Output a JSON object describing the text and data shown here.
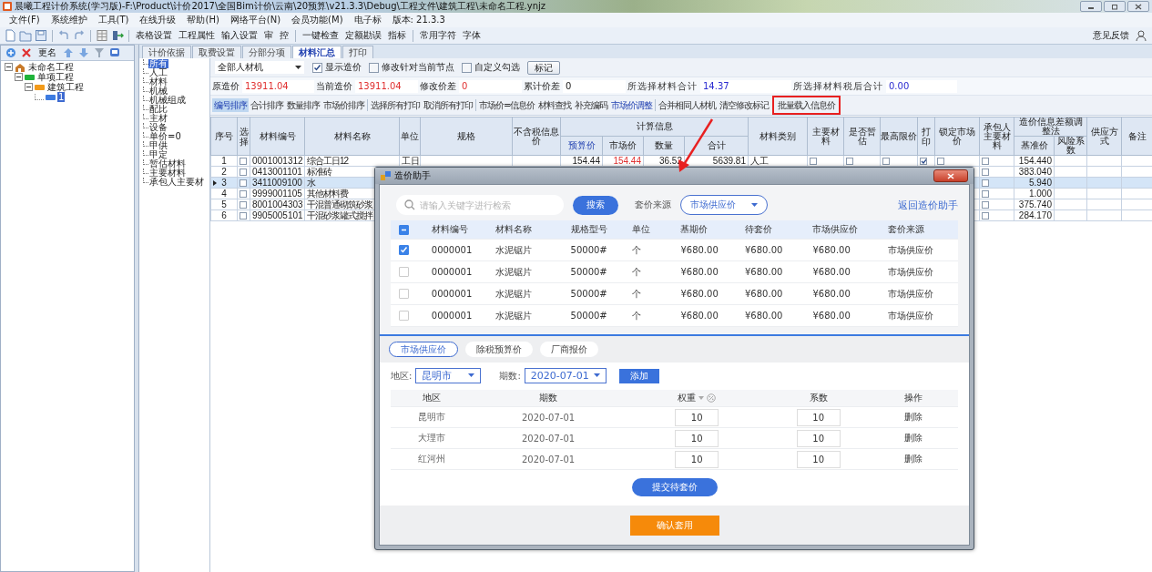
{
  "window": {
    "title": "晨曦工程计价系统(学习版)-F:\\Product\\计价2017\\全国Bim计价\\云南\\20预算\\v21.3.3\\Debug\\工程文件\\建筑工程\\未命名工程.ynjz"
  },
  "menu": [
    "文件(F)",
    "系统维护",
    "工具(T)",
    "在线升级",
    "帮助(H)",
    "网络平台(N)",
    "会员功能(M)",
    "电子标"
  ],
  "version": "版本: 21.3.3",
  "toolbar": [
    "表格设置",
    "工程属性",
    "输入设置",
    "审",
    "控",
    "一键检查",
    "定额勘误",
    "指标",
    "常用字符",
    "字体"
  ],
  "feedback": "意见反馈",
  "tree_toolbar": {
    "rename": "更名"
  },
  "tree": [
    {
      "label": "未命名工程",
      "kind": "project",
      "expanded": true,
      "selected": false,
      "children": [
        {
          "label": "单项工程",
          "kind": "single",
          "expanded": true,
          "selected": false,
          "children": [
            {
              "label": "建筑工程",
              "kind": "unit",
              "expanded": true,
              "selected": false,
              "children": [
                {
                  "label": "1",
                  "kind": "leaf",
                  "selected": true
                }
              ]
            }
          ]
        }
      ]
    }
  ],
  "tabs": [
    {
      "label": "计价依据",
      "selected": false
    },
    {
      "label": "取费设置",
      "selected": false
    },
    {
      "label": "分部分项",
      "selected": false
    },
    {
      "label": "材料汇总",
      "selected": true
    },
    {
      "label": "打印",
      "selected": false
    }
  ],
  "categories": [
    {
      "label": "所有",
      "selected": true
    },
    {
      "label": "人工",
      "selected": false
    },
    {
      "label": "材料",
      "selected": false
    },
    {
      "label": "机械",
      "selected": false
    },
    {
      "label": "机械组成",
      "selected": false
    },
    {
      "label": "配比",
      "selected": false
    },
    {
      "label": "主材",
      "selected": false
    },
    {
      "label": "设备",
      "selected": false
    },
    {
      "label": "单价=0",
      "selected": false
    },
    {
      "label": "甲供",
      "selected": false
    },
    {
      "label": "甲定",
      "selected": false
    },
    {
      "label": "暂估材料",
      "selected": false
    },
    {
      "label": "主要材料",
      "selected": false
    },
    {
      "label": "承包人主要材",
      "selected": false
    }
  ],
  "filter": {
    "dropdown": "全部人材机",
    "options": [
      {
        "label": "显示造价",
        "checked": true
      },
      {
        "label": "修改针对当前节点",
        "checked": false
      },
      {
        "label": "自定义勾选",
        "checked": false
      }
    ],
    "button": "标记"
  },
  "summary": [
    {
      "label": "原造价",
      "value": "13911.04"
    },
    {
      "label": "当前造价",
      "value": "13911.04"
    },
    {
      "label": "修改价差",
      "value": "0"
    },
    {
      "label": "累计价差",
      "value": "0"
    },
    {
      "label": "所选择材料合计",
      "value": "14.37"
    },
    {
      "label": "所选择材料税后合计",
      "value": "0.00"
    }
  ],
  "actions": [
    [
      {
        "label": "编号排序",
        "kind": "plain",
        "selected": true,
        "highlighted": false
      },
      {
        "label": "合计排序",
        "kind": "plain",
        "selected": false,
        "highlighted": false
      },
      {
        "label": "数量排序",
        "kind": "plain",
        "selected": false,
        "highlighted": false
      },
      {
        "label": "市场价排序",
        "kind": "plain",
        "selected": false,
        "highlighted": false
      }
    ],
    [
      {
        "label": "选择所有打印",
        "kind": "plain",
        "selected": false,
        "highlighted": false
      },
      {
        "label": "取消所有打印",
        "kind": "plain",
        "selected": false,
        "highlighted": false
      }
    ],
    [
      {
        "label": "市场价=信息价",
        "kind": "plain",
        "selected": false,
        "highlighted": false
      },
      {
        "label": "材料查找",
        "kind": "plain",
        "selected": false,
        "highlighted": false
      },
      {
        "label": "补充编码",
        "kind": "plain",
        "selected": false,
        "highlighted": false
      },
      {
        "label": "市场价调整",
        "kind": "link",
        "selected": false,
        "highlighted": false
      }
    ],
    [
      {
        "label": "合并相同人材机",
        "kind": "plain",
        "selected": false,
        "highlighted": false
      },
      {
        "label": "清空修改标记",
        "kind": "plain",
        "selected": false,
        "highlighted": false
      },
      {
        "label": "批量载入信息价",
        "kind": "plain",
        "selected": false,
        "highlighted": true
      }
    ]
  ],
  "table": {
    "columns": [
      {
        "label": "序号"
      },
      {
        "label": "选择"
      },
      {
        "label": "材料编号"
      },
      {
        "label": "材料名称"
      },
      {
        "label": "单位"
      },
      {
        "label": "规格"
      },
      {
        "label": "不含税信息价"
      },
      {
        "group": "计算信息",
        "colspan": 4,
        "children": [
          {
            "label": "预算价",
            "selected": true
          },
          {
            "label": "市场价",
            "selected": false
          },
          {
            "label": "数量",
            "selected": false
          },
          {
            "label": "合计",
            "selected": false
          }
        ]
      },
      {
        "label": "材料类别"
      },
      {
        "label": "主要材料"
      },
      {
        "label": "是否暂估"
      },
      {
        "label": "最高限价"
      },
      {
        "label": "打印"
      },
      {
        "label": "锁定市场价"
      },
      {
        "label": "承包人主要材料"
      },
      {
        "group": "造价信息差额调整法",
        "colspan": 2,
        "children": [
          {
            "label": "基准价",
            "selected": false
          },
          {
            "label": "风险系数",
            "selected": false
          }
        ]
      },
      {
        "label": "供应方式"
      },
      {
        "label": "备注"
      }
    ],
    "rows": [
      {
        "current": false,
        "cells": [
          "1",
          {
            "checked": false
          },
          "0001001312",
          "综合工日12",
          "工日",
          null,
          null,
          "154.44",
          "154.44",
          "36.52",
          "5639.81",
          "人工",
          {
            "checked": false
          },
          {
            "checked": false
          },
          {
            "checked": false
          },
          {
            "checked": true
          },
          {
            "checked": false
          },
          {
            "checked": false
          },
          "154.440",
          null,
          null,
          null
        ]
      },
      {
        "current": false,
        "cells": [
          "2",
          {
            "checked": false
          },
          "0413001101",
          "标准砖",
          null,
          null,
          null,
          null,
          null,
          null,
          null,
          null,
          null,
          null,
          null,
          null,
          null,
          {
            "checked": false
          },
          "383.040",
          null,
          null,
          null
        ]
      },
      {
        "current": true,
        "cells": [
          "3",
          {
            "checked": false
          },
          "3411009100",
          "水",
          null,
          null,
          null,
          null,
          null,
          null,
          null,
          null,
          null,
          null,
          null,
          null,
          null,
          {
            "checked": false
          },
          "5.940",
          null,
          null,
          null
        ]
      },
      {
        "current": false,
        "cells": [
          "4",
          {
            "checked": false
          },
          "9999001105",
          "其他材料费",
          null,
          null,
          null,
          null,
          null,
          null,
          null,
          null,
          null,
          null,
          null,
          null,
          null,
          {
            "checked": false
          },
          "1.000",
          null,
          null,
          null
        ]
      },
      {
        "current": false,
        "cells": [
          "5",
          {
            "checked": false
          },
          "8001004303",
          "干混普通砌筑砂浆",
          null,
          null,
          null,
          null,
          null,
          null,
          null,
          null,
          null,
          null,
          null,
          null,
          null,
          {
            "checked": false
          },
          "375.740",
          null,
          null,
          null
        ]
      },
      {
        "current": false,
        "cells": [
          "6",
          {
            "checked": false
          },
          "9905005101",
          "干混砂浆罐式搅拌",
          null,
          null,
          null,
          null,
          null,
          null,
          null,
          null,
          null,
          null,
          null,
          null,
          null,
          {
            "checked": false
          },
          "284.170",
          null,
          null,
          null
        ]
      }
    ]
  },
  "dialog": {
    "title": "造价助手",
    "search": {
      "placeholder": "请输入关键字进行检索",
      "button": "搜索"
    },
    "source_label": "套价来源",
    "source": "市场供应价",
    "back_link": "返回造价助手",
    "header_indeterminate": true,
    "columns": [
      "材料编号",
      "材料名称",
      "规格型号",
      "单位",
      "基期价",
      "待套价",
      "市场供应价",
      "套价来源"
    ],
    "rows": [
      {
        "checked": true,
        "code": "0000001",
        "name": "水泥锯片",
        "spec": "50000#",
        "unit": "个",
        "base_price": "¥680.00",
        "pending_price": "¥680.00",
        "market_price": "¥680.00",
        "source": "市场供应价"
      },
      {
        "checked": false,
        "code": "0000001",
        "name": "水泥锯片",
        "spec": "50000#",
        "unit": "个",
        "base_price": "¥680.00",
        "pending_price": "¥680.00",
        "market_price": "¥680.00",
        "source": "市场供应价"
      },
      {
        "checked": false,
        "code": "0000001",
        "name": "水泥锯片",
        "spec": "50000#",
        "unit": "个",
        "base_price": "¥680.00",
        "pending_price": "¥680.00",
        "market_price": "¥680.00",
        "source": "市场供应价"
      },
      {
        "checked": false,
        "code": "0000001",
        "name": "水泥锯片",
        "spec": "50000#",
        "unit": "个",
        "base_price": "¥680.00",
        "pending_price": "¥680.00",
        "market_price": "¥680.00",
        "source": "市场供应价"
      }
    ],
    "tabs": [
      {
        "label": "市场供应价",
        "selected": true
      },
      {
        "label": "除税预算价",
        "selected": false
      },
      {
        "label": "厂商报价",
        "selected": false
      }
    ],
    "region_label": "地区:",
    "region": "昆明市",
    "period_label": "期数:",
    "period": "2020-07-01",
    "add_button": "添加",
    "price_columns": [
      "地区",
      "期数",
      "权重",
      "系数",
      "操作"
    ],
    "price_rows": [
      {
        "region": "昆明市",
        "period": "2020-07-01",
        "weight": "10",
        "coefficient": "10",
        "action": "删除"
      },
      {
        "region": "大理市",
        "period": "2020-07-01",
        "weight": "10",
        "coefficient": "10",
        "action": "删除"
      },
      {
        "region": "红河州",
        "period": "2020-07-01",
        "weight": "10",
        "coefficient": "10",
        "action": "删除"
      }
    ],
    "submit_button": "提交待套价",
    "confirm_button": "确认套用"
  }
}
